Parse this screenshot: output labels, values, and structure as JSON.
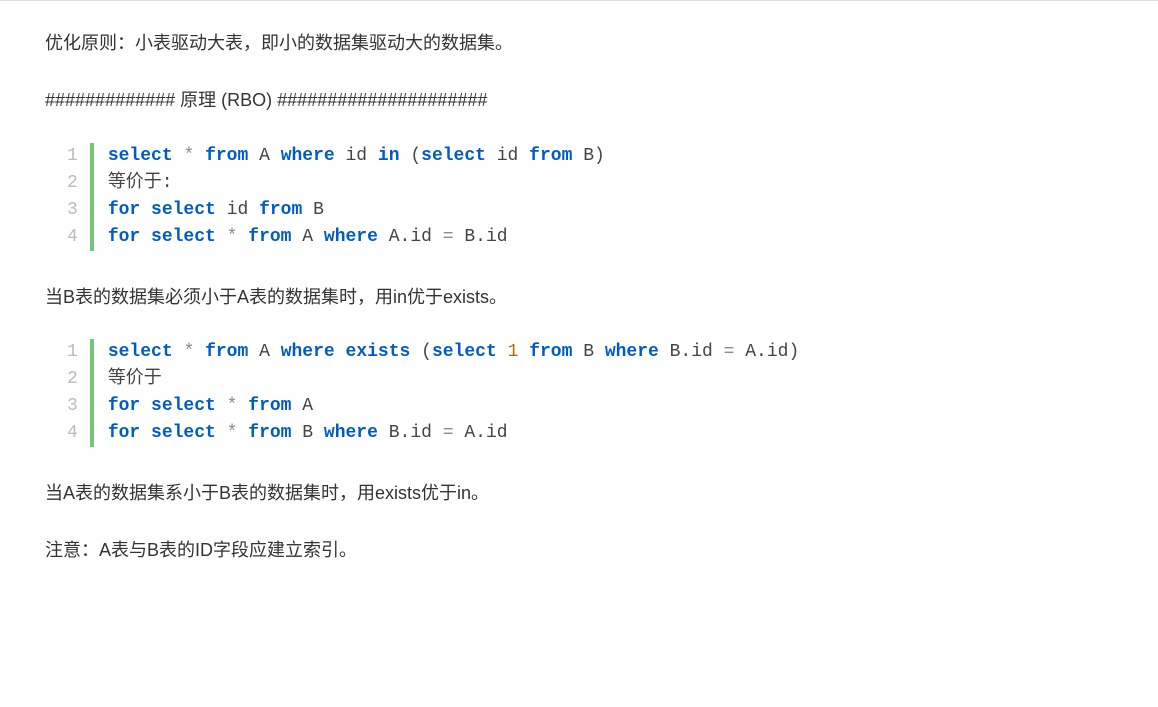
{
  "p1": "优化原则：小表驱动大表，即小的数据集驱动大的数据集。",
  "p2": "############# 原理 (RBO) #####################",
  "code1": {
    "line1": {
      "t1": "select",
      "t2": " ",
      "t3": "*",
      "t4": " ",
      "t5": "from",
      "t6": " A ",
      "t7": "where",
      "t8": " id ",
      "t9": "in",
      "t10": " (",
      "t11": "select",
      "t12": " id ",
      "t13": "from",
      "t14": " B)"
    },
    "line2": "等价于:",
    "line3": {
      "t1": "for",
      "t2": " ",
      "t3": "select",
      "t4": " id ",
      "t5": "from",
      "t6": " B"
    },
    "line4": {
      "t1": "for",
      "t2": " ",
      "t3": "select",
      "t4": " ",
      "t5": "*",
      "t6": " ",
      "t7": "from",
      "t8": " A ",
      "t9": "where",
      "t10": " A.id ",
      "t11": "=",
      "t12": " B.id"
    }
  },
  "p3": "当B表的数据集必须小于A表的数据集时，用in优于exists。",
  "code2": {
    "line1": {
      "t1": "select",
      "t2": " ",
      "t3": "*",
      "t4": " ",
      "t5": "from",
      "t6": " A ",
      "t7": "where",
      "t8": " ",
      "t9": "exists",
      "t10": " (",
      "t11": "select",
      "t12": " ",
      "t13": "1",
      "t14": " ",
      "t15": "from",
      "t16": " B ",
      "t17": "where",
      "t18": " B.id ",
      "t19": "=",
      "t20": " A.id)"
    },
    "line2": "等价于",
    "line3": {
      "t1": "for",
      "t2": " ",
      "t3": "select",
      "t4": " ",
      "t5": "*",
      "t6": " ",
      "t7": "from",
      "t8": " A"
    },
    "line4": {
      "t1": "for",
      "t2": " ",
      "t3": "select",
      "t4": " ",
      "t5": "*",
      "t6": " ",
      "t7": "from",
      "t8": " B ",
      "t9": "where",
      "t10": " B.id ",
      "t11": "=",
      "t12": " A.id"
    }
  },
  "p4": "当A表的数据集系小于B表的数据集时，用exists优于in。",
  "p5": "注意：A表与B表的ID字段应建立索引。",
  "ln": {
    "l1": "1",
    "l2": "2",
    "l3": "3",
    "l4": "4"
  }
}
